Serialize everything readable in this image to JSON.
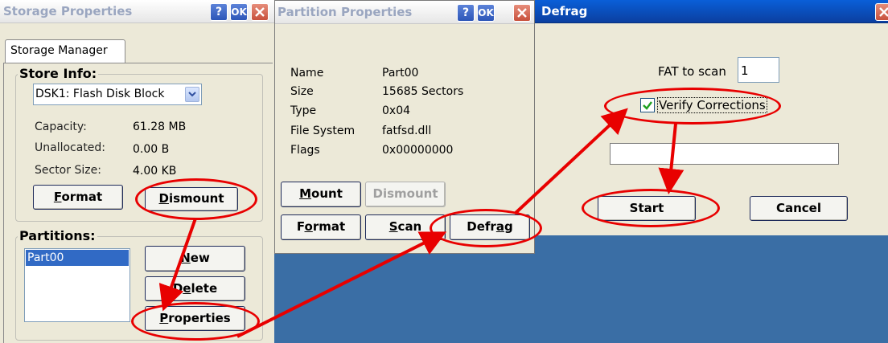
{
  "storage_window": {
    "title": "Storage Properties",
    "tab": "Storage Manager",
    "store_info_heading": "Store Info:",
    "disk_selected": "DSK1: Flash Disk Block",
    "info": [
      {
        "label": "Capacity:",
        "value": "61.28 MB"
      },
      {
        "label": "Unallocated:",
        "value": "0.00 B"
      },
      {
        "label": "Sector Size:",
        "value": "4.00 KB"
      }
    ],
    "format_label": "Format",
    "dismount_label": "Dismount",
    "partitions_heading": "Partitions:",
    "partitions": [
      "Part00"
    ],
    "new_label": "New",
    "delete_label": "Delete",
    "properties_label": "Properties"
  },
  "partition_window": {
    "title": "Partition Properties",
    "rows": [
      {
        "label": "Name",
        "value": "Part00"
      },
      {
        "label": "Size",
        "value": "15685 Sectors"
      },
      {
        "label": "Type",
        "value": "0x04"
      },
      {
        "label": "File System",
        "value": "fatfsd.dll"
      },
      {
        "label": "Flags",
        "value": "0x00000000"
      }
    ],
    "mount_label": "Mount",
    "dismount_label": "Dismount",
    "format_label": "Format",
    "scan_label": "Scan",
    "defrag_label": "Defrag"
  },
  "defrag_window": {
    "title": "Defrag",
    "fat_label": "FAT to scan",
    "fat_value": "1",
    "verify_label": "Verify Corrections",
    "progress": 0,
    "start_label": "Start",
    "cancel_label": "Cancel"
  },
  "titlebar_buttons": {
    "help": "?",
    "ok": "OK"
  },
  "colors": {
    "annotation": "#e80000",
    "desktop": "#3a6ea5",
    "titlebar_active": "#0b4fc0"
  }
}
